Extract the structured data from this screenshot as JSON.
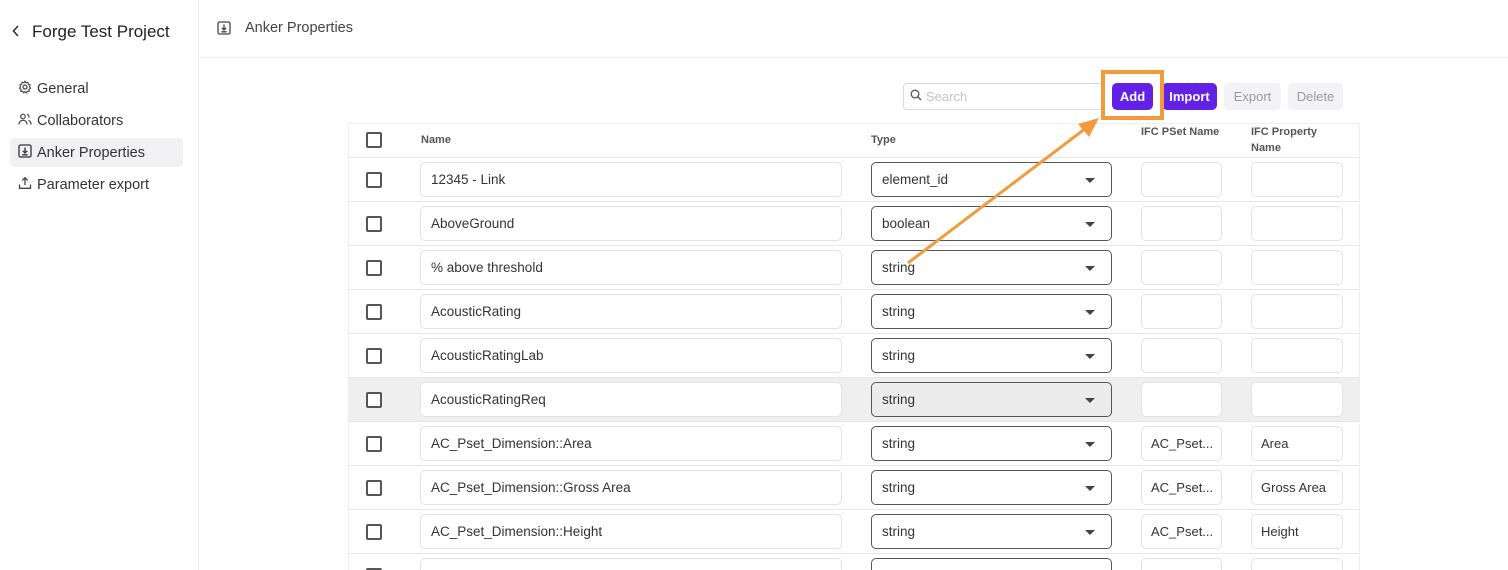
{
  "sidebar": {
    "project_title": "Forge Test Project",
    "items": [
      {
        "label": "General",
        "icon": "gear-icon",
        "active": false
      },
      {
        "label": "Collaborators",
        "icon": "users-icon",
        "active": false
      },
      {
        "label": "Anker Properties",
        "icon": "download-box-icon",
        "active": true
      },
      {
        "label": "Parameter export",
        "icon": "upload-icon",
        "active": false
      }
    ]
  },
  "header": {
    "title": "Anker Properties",
    "icon": "download-box-icon"
  },
  "toolbar": {
    "search_placeholder": "Search",
    "add_label": "Add",
    "import_label": "Import",
    "export_label": "Export",
    "delete_label": "Delete"
  },
  "table": {
    "columns": {
      "name": "Name",
      "type": "Type",
      "pset": "IFC PSet Name",
      "prop_line1": "IFC Property",
      "prop_line2": "Name"
    },
    "rows": [
      {
        "name": "12345 - Link",
        "type": "element_id",
        "pset": "",
        "prop": ""
      },
      {
        "name": "AboveGround",
        "type": "boolean",
        "pset": "",
        "prop": ""
      },
      {
        "name": "% above threshold",
        "type": "string",
        "pset": "",
        "prop": ""
      },
      {
        "name": "AcousticRating",
        "type": "string",
        "pset": "",
        "prop": ""
      },
      {
        "name": "AcousticRatingLab",
        "type": "string",
        "pset": "",
        "prop": ""
      },
      {
        "name": "AcousticRatingReq",
        "type": "string",
        "pset": "",
        "prop": "",
        "highlighted": true
      },
      {
        "name": "AC_Pset_Dimension::Area",
        "type": "string",
        "pset": "AC_Pset...",
        "prop": "Area"
      },
      {
        "name": "AC_Pset_Dimension::Gross Area",
        "type": "string",
        "pset": "AC_Pset...",
        "prop": "Gross Area"
      },
      {
        "name": "AC_Pset_Dimension::Height",
        "type": "string",
        "pset": "AC_Pset...",
        "prop": "Height"
      },
      {
        "name": "",
        "type": "",
        "pset": "",
        "prop": ""
      }
    ]
  },
  "colors": {
    "primary": "#6222e6",
    "annotation": "#f39a3c",
    "row_highlight": "#efefef"
  }
}
